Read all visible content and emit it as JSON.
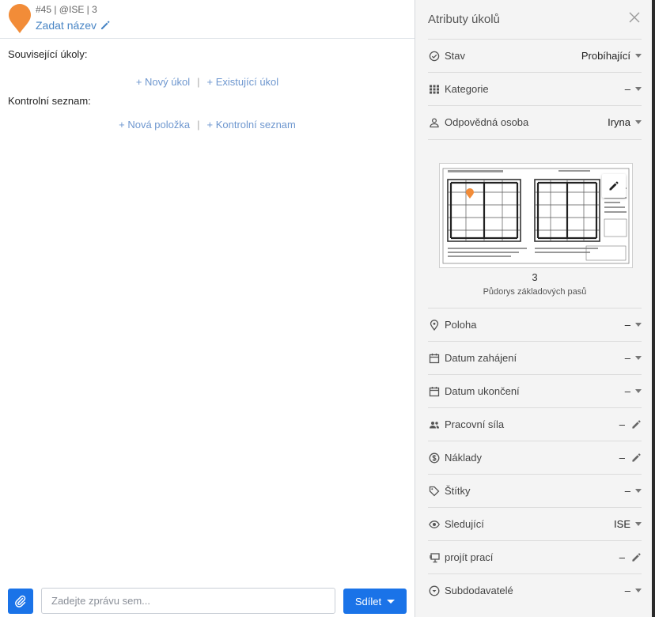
{
  "task": {
    "meta": "#45 | @ISE | 3",
    "title_placeholder": "Zadat název",
    "pin_color": "#f28c38"
  },
  "related": {
    "label": "Související úkoly:",
    "new_task": "+ Nový úkol",
    "existing_task": "+ Existující úkol",
    "separator": "|"
  },
  "checklist": {
    "label": "Kontrolní seznam:",
    "new_item": "+ Nová položka",
    "checklist_link": "+ Kontrolní seznam",
    "separator": "|"
  },
  "composer": {
    "placeholder": "Zadejte zprávu sem...",
    "share_label": "Sdílet"
  },
  "attributes": {
    "title": "Atributy úkolů",
    "rows": [
      {
        "label": "Stav",
        "value": "Probíhající",
        "icon": "check-circle-icon",
        "control": "caret"
      },
      {
        "label": "Kategorie",
        "value": "–",
        "icon": "grid-icon",
        "control": "caret"
      },
      {
        "label": "Odpovědná osoba",
        "value": "Iryna",
        "icon": "person-icon",
        "control": "caret"
      },
      {
        "label": "Poloha",
        "value": "–",
        "icon": "location-pin-icon",
        "control": "caret"
      },
      {
        "label": "Datum zahájení",
        "value": "–",
        "icon": "calendar-icon",
        "control": "caret"
      },
      {
        "label": "Datum ukončení",
        "value": "–",
        "icon": "calendar-icon",
        "control": "caret"
      },
      {
        "label": "Pracovní síla",
        "value": "–",
        "icon": "people-icon",
        "control": "pencil"
      },
      {
        "label": "Náklady",
        "value": "–",
        "icon": "dollar-circle-icon",
        "control": "pencil"
      },
      {
        "label": "Štítky",
        "value": "–",
        "icon": "tag-icon",
        "control": "caret"
      },
      {
        "label": "Sledující",
        "value": "ISE",
        "icon": "eye-icon",
        "control": "caret"
      },
      {
        "label": "projít prací",
        "value": "–",
        "icon": "monitor-icon",
        "control": "pencil"
      },
      {
        "label": "Subdodavatelé",
        "value": "–",
        "icon": "chevron-circle-icon",
        "control": "caret"
      }
    ],
    "plan": {
      "number": "3",
      "name": "Půdorys základových pasů"
    }
  },
  "colors": {
    "accent": "#1a73e8",
    "link": "#6e97cf",
    "pin": "#f28c38"
  }
}
